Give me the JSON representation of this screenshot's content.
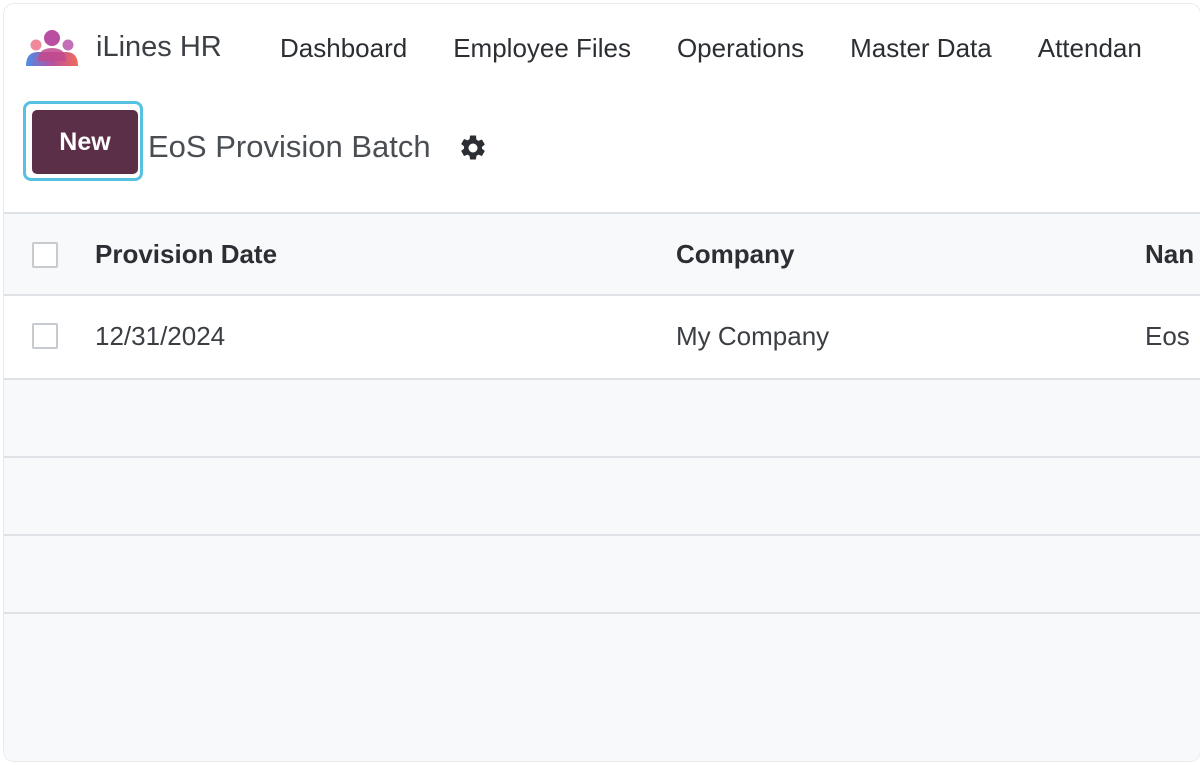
{
  "app": {
    "name": "iLines HR",
    "logo_icon": "people-group-icon",
    "logo_colors": [
      "#f26b5b",
      "#b84fa0",
      "#4a8fe7"
    ]
  },
  "menu": {
    "items": [
      {
        "label": "Dashboard"
      },
      {
        "label": "Employee Files"
      },
      {
        "label": "Operations"
      },
      {
        "label": "Master Data"
      },
      {
        "label": "Attendan"
      }
    ]
  },
  "control_panel": {
    "new_label": "New",
    "breadcrumb": "EoS Provision Batch",
    "settings_icon": "gear-icon"
  },
  "list": {
    "columns": [
      "Provision Date",
      "Company",
      "Nan"
    ],
    "rows": [
      {
        "provision_date": "12/31/2024",
        "company": "My Company",
        "name": "Eos"
      }
    ]
  },
  "colors": {
    "primary": "#5b2f48",
    "focus_ring": "#56c1e0",
    "border": "#dee2e6"
  }
}
